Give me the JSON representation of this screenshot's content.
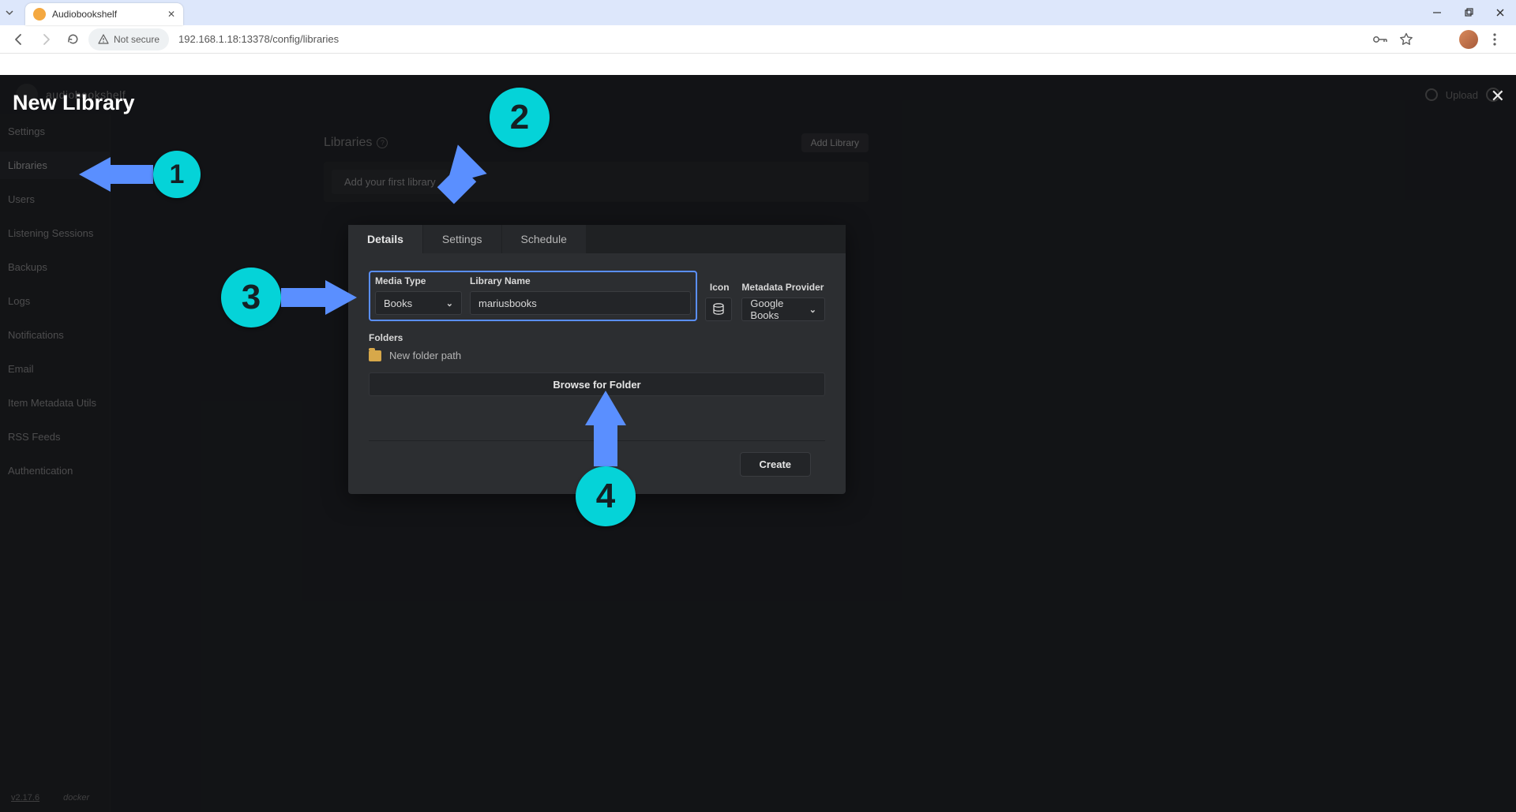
{
  "browser": {
    "tab_title": "Audiobookshelf",
    "security_label": "Not secure",
    "url": "192.168.1.18:13378/config/libraries"
  },
  "app_header": {
    "brand": "audiobookshelf",
    "user_button": "Upload"
  },
  "sidebar": {
    "items": [
      "Settings",
      "Libraries",
      "Users",
      "Listening Sessions",
      "Backups",
      "Logs",
      "Notifications",
      "Email",
      "Item Metadata Utils",
      "RSS Feeds",
      "Authentication"
    ],
    "active_index": 1,
    "version": "v2.17.6",
    "runtime": "docker"
  },
  "libraries_page": {
    "heading": "Libraries",
    "add_button": "Add Library",
    "empty_cta": "Add your first library"
  },
  "modal": {
    "title": "New Library",
    "tabs": [
      "Details",
      "Settings",
      "Schedule"
    ],
    "active_tab": 0,
    "fields": {
      "media_type_label": "Media Type",
      "media_type_value": "Books",
      "library_name_label": "Library Name",
      "library_name_value": "mariusbooks",
      "icon_label": "Icon",
      "provider_label": "Metadata Provider",
      "provider_value": "Google Books"
    },
    "folders_label": "Folders",
    "folder_placeholder": "New folder path",
    "browse_button": "Browse for Folder",
    "create_button": "Create"
  },
  "annotations": {
    "1": "1",
    "2": "2",
    "3": "3",
    "4": "4"
  }
}
